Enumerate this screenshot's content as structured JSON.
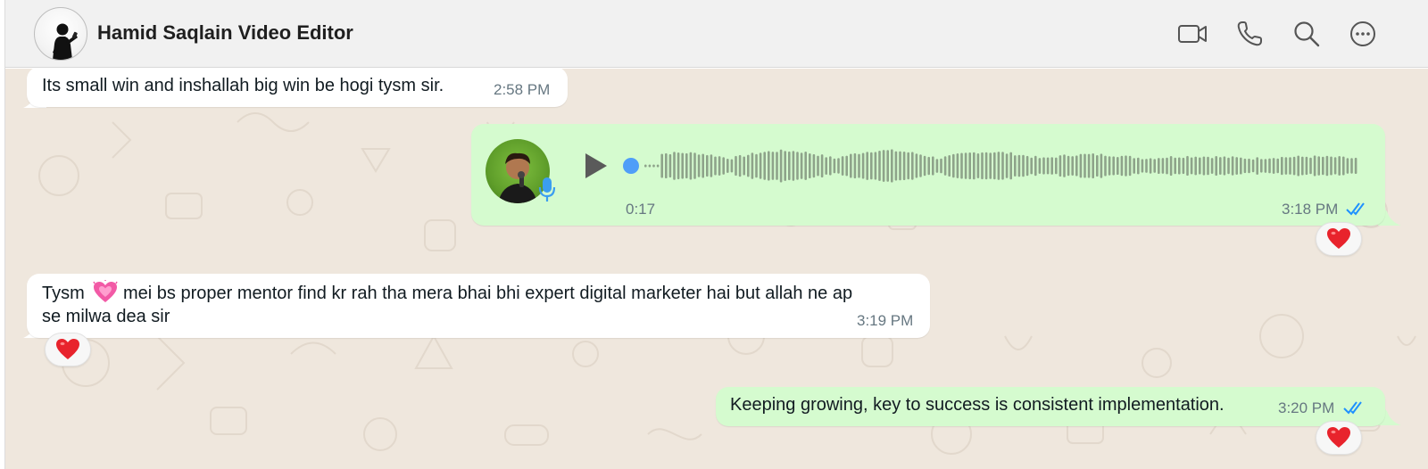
{
  "header": {
    "contact_name": "Hamid Saqlain Video Editor",
    "icons": [
      "video-call-icon",
      "voice-call-icon",
      "search-icon",
      "more-options-icon"
    ]
  },
  "messages": [
    {
      "direction": "incoming",
      "text": "Its small win and inshallah big win be hogi tysm sir.",
      "time": "2:58 PM"
    },
    {
      "direction": "outgoing",
      "type": "voice",
      "duration": "0:17",
      "time": "3:18 PM",
      "status": "read",
      "reaction": "heart"
    },
    {
      "direction": "incoming",
      "text_line1": "Tysm",
      "text_line1_rest": "mei bs proper mentor find kr rah tha mera bhai bhi expert digital marketer hai but allah ne ap",
      "text_line2": "se milwa dea sir",
      "emoji": "growing-heart",
      "time": "3:19 PM",
      "reaction": "heart"
    },
    {
      "direction": "outgoing",
      "text": "Keeping growing, key to success is consistent implementation.",
      "time": "3:20 PM",
      "status": "read",
      "reaction": "heart"
    }
  ],
  "colors": {
    "chat_bg": "#efe7dd",
    "incoming_bubble": "#ffffff",
    "outgoing_bubble": "#d5fbcf",
    "read_ticks": "#1e90ff",
    "waveform": "#8ea38a",
    "playhead": "#4f9ef8"
  }
}
